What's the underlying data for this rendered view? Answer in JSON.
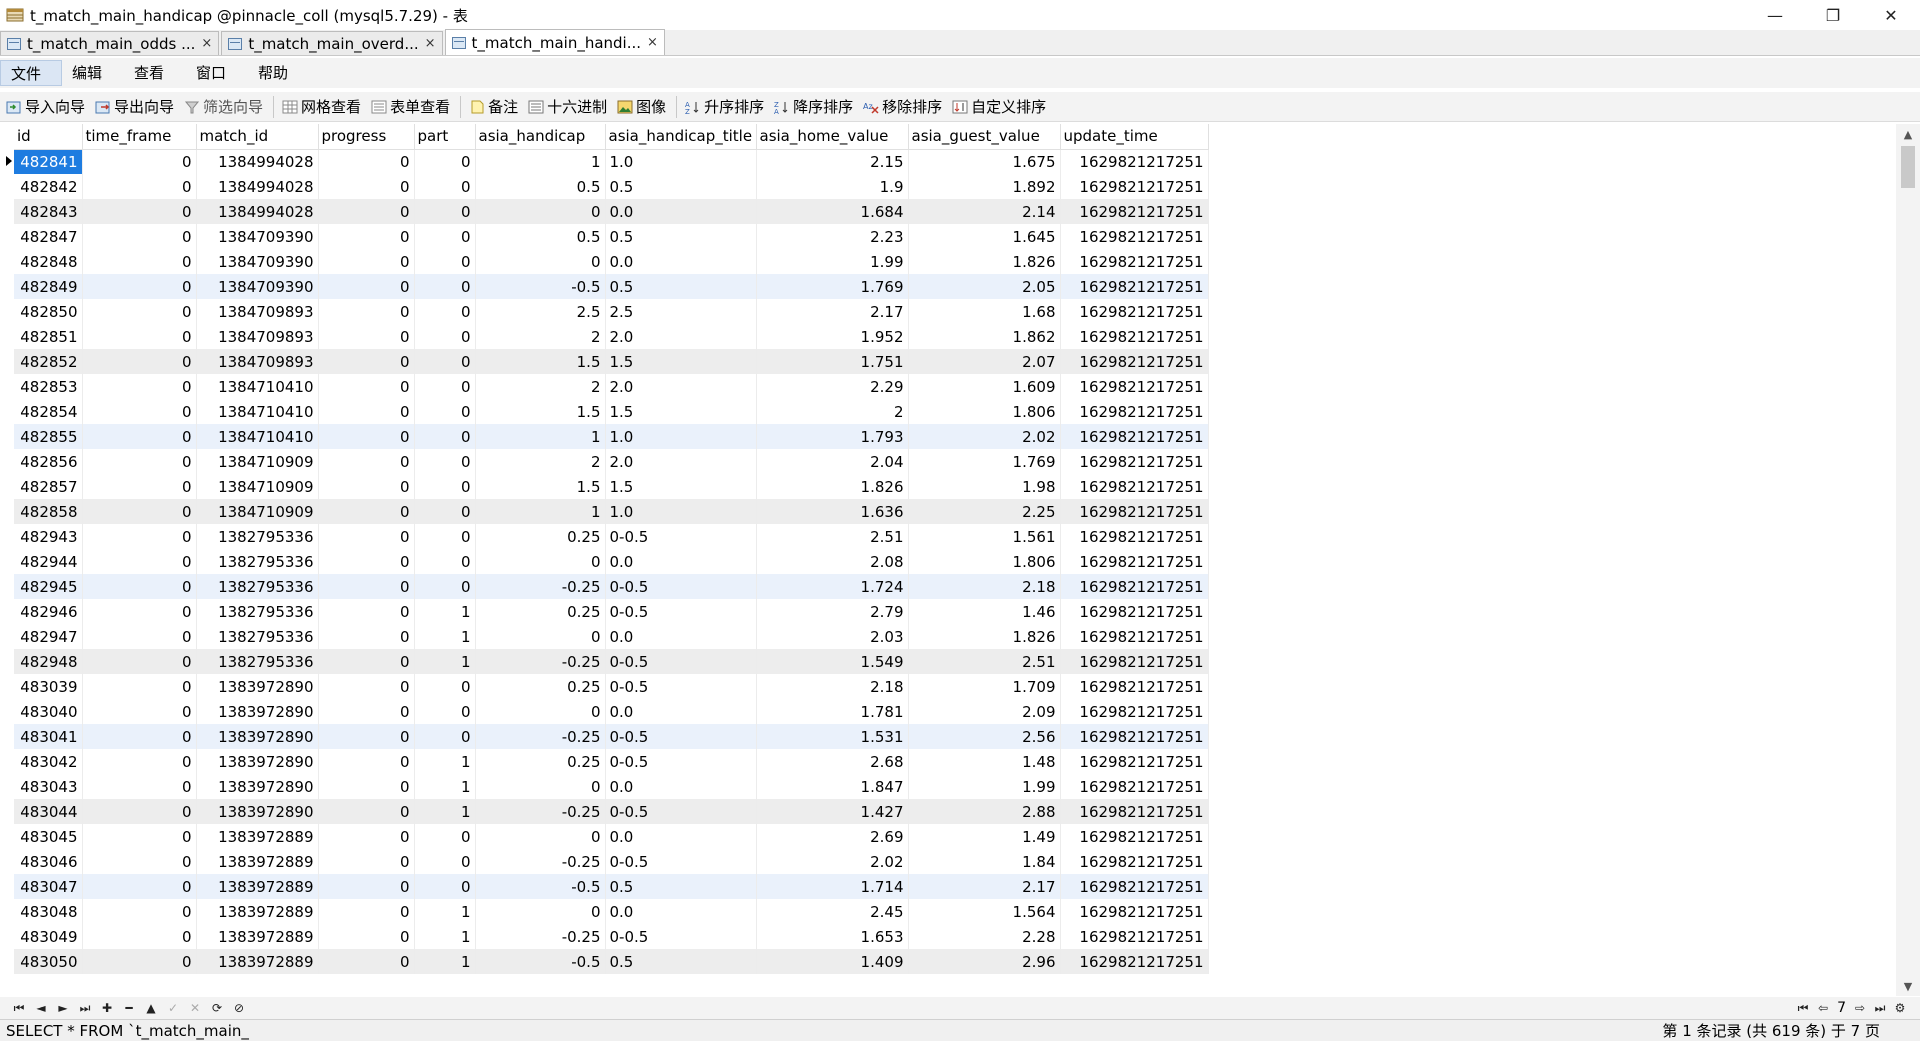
{
  "window": {
    "title": "t_match_main_handicap @pinnacle_coll (mysql5.7.29) - 表",
    "minimize": "—",
    "restore": "❐",
    "close": "✕"
  },
  "tabs": [
    {
      "label": "t_match_main_odds ...",
      "close": "×"
    },
    {
      "label": "t_match_main_overd...",
      "close": "×"
    },
    {
      "label": "t_match_main_handi...",
      "close": "×"
    }
  ],
  "menu": [
    "文件",
    "编辑",
    "查看",
    "窗口",
    "帮助"
  ],
  "toolbar": {
    "import": "导入向导",
    "export": "导出向导",
    "filter": "筛选向导",
    "grid_view": "网格查看",
    "form_view": "表单查看",
    "memo": "备注",
    "hex": "十六进制",
    "image": "图像",
    "sort_asc": "升序排序",
    "sort_desc": "降序排序",
    "remove_sort": "移除排序",
    "custom_sort": "自定义排序"
  },
  "table": {
    "columns": [
      "id",
      "time_frame",
      "match_id",
      "progress",
      "part",
      "asia_handicap",
      "asia_handicap_title",
      "asia_home_value",
      "asia_guest_value",
      "update_time"
    ],
    "rows": [
      [
        "482841",
        "0",
        "1384994028",
        "0",
        "0",
        "1",
        "1.0",
        "2.15",
        "1.675",
        "1629821217251"
      ],
      [
        "482842",
        "0",
        "1384994028",
        "0",
        "0",
        "0.5",
        "0.5",
        "1.9",
        "1.892",
        "1629821217251"
      ],
      [
        "482843",
        "0",
        "1384994028",
        "0",
        "0",
        "0",
        "0.0",
        "1.684",
        "2.14",
        "1629821217251"
      ],
      [
        "482847",
        "0",
        "1384709390",
        "0",
        "0",
        "0.5",
        "0.5",
        "2.23",
        "1.645",
        "1629821217251"
      ],
      [
        "482848",
        "0",
        "1384709390",
        "0",
        "0",
        "0",
        "0.0",
        "1.99",
        "1.826",
        "1629821217251"
      ],
      [
        "482849",
        "0",
        "1384709390",
        "0",
        "0",
        "-0.5",
        "0.5",
        "1.769",
        "2.05",
        "1629821217251"
      ],
      [
        "482850",
        "0",
        "1384709893",
        "0",
        "0",
        "2.5",
        "2.5",
        "2.17",
        "1.68",
        "1629821217251"
      ],
      [
        "482851",
        "0",
        "1384709893",
        "0",
        "0",
        "2",
        "2.0",
        "1.952",
        "1.862",
        "1629821217251"
      ],
      [
        "482852",
        "0",
        "1384709893",
        "0",
        "0",
        "1.5",
        "1.5",
        "1.751",
        "2.07",
        "1629821217251"
      ],
      [
        "482853",
        "0",
        "1384710410",
        "0",
        "0",
        "2",
        "2.0",
        "2.29",
        "1.609",
        "1629821217251"
      ],
      [
        "482854",
        "0",
        "1384710410",
        "0",
        "0",
        "1.5",
        "1.5",
        "2",
        "1.806",
        "1629821217251"
      ],
      [
        "482855",
        "0",
        "1384710410",
        "0",
        "0",
        "1",
        "1.0",
        "1.793",
        "2.02",
        "1629821217251"
      ],
      [
        "482856",
        "0",
        "1384710909",
        "0",
        "0",
        "2",
        "2.0",
        "2.04",
        "1.769",
        "1629821217251"
      ],
      [
        "482857",
        "0",
        "1384710909",
        "0",
        "0",
        "1.5",
        "1.5",
        "1.826",
        "1.98",
        "1629821217251"
      ],
      [
        "482858",
        "0",
        "1384710909",
        "0",
        "0",
        "1",
        "1.0",
        "1.636",
        "2.25",
        "1629821217251"
      ],
      [
        "482943",
        "0",
        "1382795336",
        "0",
        "0",
        "0.25",
        "0-0.5",
        "2.51",
        "1.561",
        "1629821217251"
      ],
      [
        "482944",
        "0",
        "1382795336",
        "0",
        "0",
        "0",
        "0.0",
        "2.08",
        "1.806",
        "1629821217251"
      ],
      [
        "482945",
        "0",
        "1382795336",
        "0",
        "0",
        "-0.25",
        "0-0.5",
        "1.724",
        "2.18",
        "1629821217251"
      ],
      [
        "482946",
        "0",
        "1382795336",
        "0",
        "1",
        "0.25",
        "0-0.5",
        "2.79",
        "1.46",
        "1629821217251"
      ],
      [
        "482947",
        "0",
        "1382795336",
        "0",
        "1",
        "0",
        "0.0",
        "2.03",
        "1.826",
        "1629821217251"
      ],
      [
        "482948",
        "0",
        "1382795336",
        "0",
        "1",
        "-0.25",
        "0-0.5",
        "1.549",
        "2.51",
        "1629821217251"
      ],
      [
        "483039",
        "0",
        "1383972890",
        "0",
        "0",
        "0.25",
        "0-0.5",
        "2.18",
        "1.709",
        "1629821217251"
      ],
      [
        "483040",
        "0",
        "1383972890",
        "0",
        "0",
        "0",
        "0.0",
        "1.781",
        "2.09",
        "1629821217251"
      ],
      [
        "483041",
        "0",
        "1383972890",
        "0",
        "0",
        "-0.25",
        "0-0.5",
        "1.531",
        "2.56",
        "1629821217251"
      ],
      [
        "483042",
        "0",
        "1383972890",
        "0",
        "1",
        "0.25",
        "0-0.5",
        "2.68",
        "1.48",
        "1629821217251"
      ],
      [
        "483043",
        "0",
        "1383972890",
        "0",
        "1",
        "0",
        "0.0",
        "1.847",
        "1.99",
        "1629821217251"
      ],
      [
        "483044",
        "0",
        "1383972890",
        "0",
        "1",
        "-0.25",
        "0-0.5",
        "1.427",
        "2.88",
        "1629821217251"
      ],
      [
        "483045",
        "0",
        "1383972889",
        "0",
        "0",
        "0",
        "0.0",
        "2.69",
        "1.49",
        "1629821217251"
      ],
      [
        "483046",
        "0",
        "1383972889",
        "0",
        "0",
        "-0.25",
        "0-0.5",
        "2.02",
        "1.84",
        "1629821217251"
      ],
      [
        "483047",
        "0",
        "1383972889",
        "0",
        "0",
        "-0.5",
        "0.5",
        "1.714",
        "2.17",
        "1629821217251"
      ],
      [
        "483048",
        "0",
        "1383972889",
        "0",
        "1",
        "0",
        "0.0",
        "2.45",
        "1.564",
        "1629821217251"
      ],
      [
        "483049",
        "0",
        "1383972889",
        "0",
        "1",
        "-0.25",
        "0-0.5",
        "1.653",
        "2.28",
        "1629821217251"
      ],
      [
        "483050",
        "0",
        "1383972889",
        "0",
        "1",
        "-0.5",
        "0.5",
        "1.409",
        "2.96",
        "1629821217251"
      ]
    ]
  },
  "pager": {
    "page": "7"
  },
  "status": {
    "sql": "SELECT * FROM `t_match_main_ha",
    "records": "第 1 条记录 (共 619 条) 于 7 页"
  },
  "icons": {
    "title": "database-table-icon",
    "first": "⏮",
    "prev": "◄",
    "next": "►",
    "last": "⏭"
  }
}
